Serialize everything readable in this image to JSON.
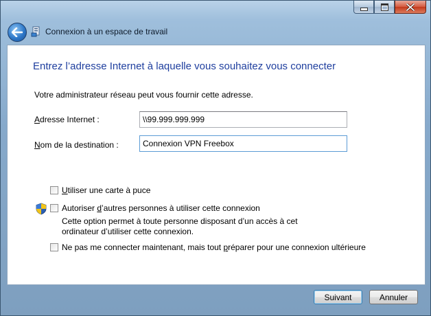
{
  "window": {
    "minimize_icon": "minimize-icon",
    "maximize_icon": "maximize-icon",
    "close_icon": "close-icon"
  },
  "nav": {
    "back_icon": "back-arrow-icon",
    "title": "Connexion à un espace de travail",
    "icon": "network-connection-icon"
  },
  "content": {
    "heading": "Entrez l’adresse Internet à laquelle vous souhaitez vous connecter",
    "description": "Votre administrateur réseau peut vous fournir cette adresse.",
    "address_label_u": "A",
    "address_label_rest": "dresse Internet :",
    "address_value": "\\\\99.999.999.999",
    "destination_label_u": "N",
    "destination_label_rest": "om de la destination :",
    "destination_value": "Connexion VPN Freebox",
    "smartcard_u": "U",
    "smartcard_rest": "tiliser une carte à puce",
    "allow_pre": "Autoriser ",
    "allow_u": "d",
    "allow_rest": "’autres personnes à utiliser cette connexion",
    "allow_note": "Cette option permet à toute personne disposant d’un accès à cet ordinateur d’utiliser cette connexion.",
    "later_pre": "Ne pas me connecter maintenant, mais tout ",
    "later_u": "p",
    "later_rest": "réparer pour une connexion ultérieure",
    "shield_icon": "uac-shield-icon"
  },
  "buttons": {
    "next": "Suivant",
    "cancel": "Annuler"
  }
}
